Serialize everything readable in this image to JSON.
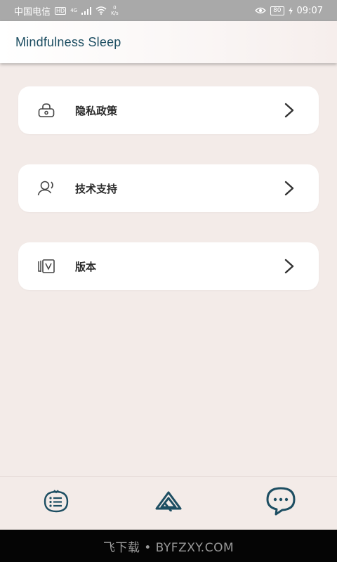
{
  "status_bar": {
    "carrier": "中国电信",
    "hd": "HD",
    "network": "4G",
    "speed_value": "0",
    "speed_unit": "K/s",
    "battery": "80",
    "time": "09:07"
  },
  "header": {
    "title": "Mindfulness Sleep"
  },
  "menu": {
    "items": [
      {
        "label": "隐私政策",
        "icon": "lock-icon"
      },
      {
        "label": "技术支持",
        "icon": "support-person-icon"
      },
      {
        "label": "版本",
        "icon": "version-icon"
      }
    ]
  },
  "bottom_nav": {
    "items": [
      {
        "icon": "list-icon"
      },
      {
        "icon": "mountain-logo-icon"
      },
      {
        "icon": "chat-bubble-icon"
      }
    ],
    "colors": {
      "icon": "#1d4e62"
    }
  },
  "watermark": {
    "text": "飞下载 • BYFZXY.COM"
  }
}
